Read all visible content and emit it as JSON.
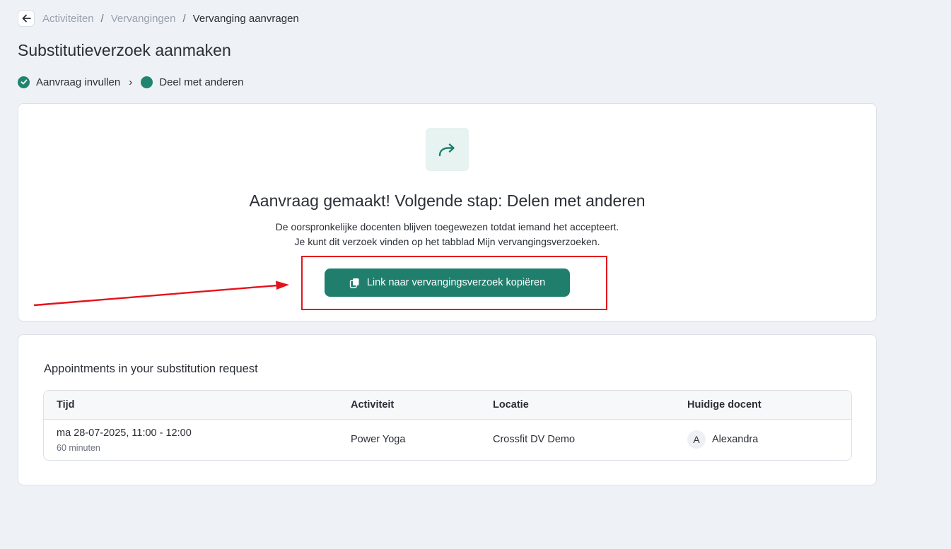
{
  "breadcrumb": {
    "items": [
      "Activiteiten",
      "Vervangingen"
    ],
    "current": "Vervanging aanvragen",
    "separator": "/"
  },
  "page": {
    "title": "Substitutieverzoek aanmaken"
  },
  "steps": [
    {
      "label": "Aanvraag invullen",
      "state": "completed"
    },
    {
      "label": "Deel met anderen",
      "state": "active"
    }
  ],
  "share": {
    "icon": "share-forward-icon",
    "title": "Aanvraag gemaakt! Volgende stap: Delen met anderen",
    "desc_line1": "De oorspronkelijke docenten blijven toegewezen totdat iemand het accepteert.",
    "desc_line2": "Je kunt dit verzoek vinden op het tabblad Mijn vervangingsverzoeken.",
    "copy_button": "Link naar vervangingsverzoek kopiëren"
  },
  "appointments": {
    "title": "Appointments in your substitution request",
    "columns": [
      "Tijd",
      "Activiteit",
      "Locatie",
      "Huidige docent"
    ],
    "rows": [
      {
        "time": "ma 28-07-2025, 11:00 - 12:00",
        "duration": "60 minuten",
        "activity": "Power Yoga",
        "location": "Crossfit DV Demo",
        "teacher_initial": "A",
        "teacher": "Alexandra"
      }
    ]
  },
  "colors": {
    "accent": "#1f7f6c",
    "annotation": "#e5121b",
    "background": "#eef1f5"
  }
}
